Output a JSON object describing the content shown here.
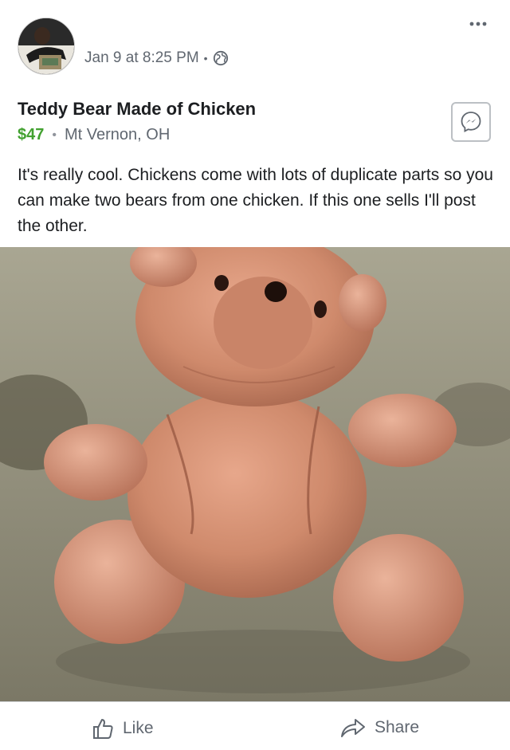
{
  "post": {
    "timestamp": "Jan 9 at 8:25 PM",
    "separator": "•",
    "privacy_icon": "globe-icon",
    "more_icon": "more-options-icon"
  },
  "listing": {
    "title": "Teddy Bear Made of Chicken",
    "price": "$47",
    "separator": "•",
    "location": "Mt Vernon, OH",
    "description": "It's really cool. Chickens come with lots of duplicate parts so you can make two bears from one chicken. If this one sells I'll post the other.",
    "messenger_icon": "messenger-icon"
  },
  "actions": {
    "like_label": "Like",
    "share_label": "Share"
  },
  "colors": {
    "price": "#42a130",
    "secondary_text": "#606770",
    "primary_text": "#1c1e21",
    "divider": "#dadde1"
  }
}
